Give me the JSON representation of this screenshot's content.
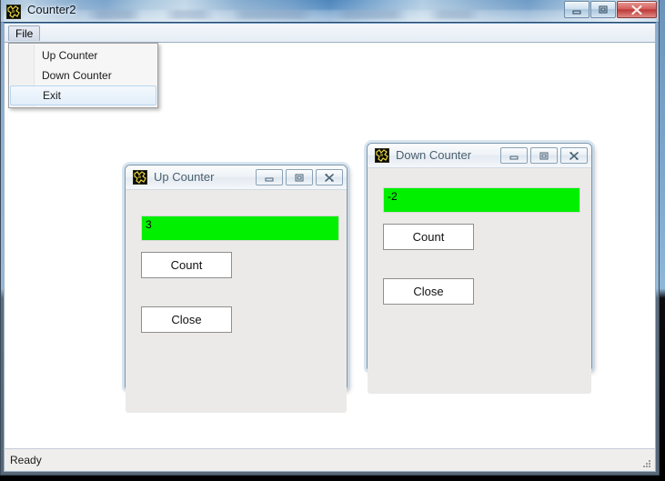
{
  "main_window": {
    "title": "Counter2",
    "icon": "app-icon",
    "caption_buttons": [
      {
        "name": "minimize",
        "glyph": "minimize-icon"
      },
      {
        "name": "maximize",
        "glyph": "maximize-icon"
      },
      {
        "name": "close",
        "glyph": "close-icon"
      }
    ],
    "menubar": {
      "items": [
        {
          "label": "File"
        }
      ]
    },
    "dropdown": {
      "open": true,
      "items": [
        {
          "label": "Up Counter",
          "highlighted": false
        },
        {
          "label": "Down Counter",
          "highlighted": false
        },
        {
          "label": "Exit",
          "highlighted": true
        }
      ]
    },
    "statusbar": {
      "text": "Ready"
    }
  },
  "child_windows": [
    {
      "id": "up-counter",
      "title": "Up Counter",
      "icon": "app-icon",
      "counter_value": "3",
      "buttons": [
        {
          "label": "Count"
        },
        {
          "label": "Close"
        }
      ],
      "caption_buttons": [
        {
          "name": "minimize",
          "glyph": "minimize-icon"
        },
        {
          "name": "maximize",
          "glyph": "maximize-icon"
        },
        {
          "name": "close",
          "glyph": "close-icon"
        }
      ]
    },
    {
      "id": "down-counter",
      "title": "Down Counter",
      "icon": "app-icon",
      "counter_value": "-2",
      "buttons": [
        {
          "label": "Count"
        },
        {
          "label": "Close"
        }
      ],
      "caption_buttons": [
        {
          "name": "minimize",
          "glyph": "minimize-icon"
        },
        {
          "name": "maximize",
          "glyph": "maximize-icon"
        },
        {
          "name": "close",
          "glyph": "close-icon"
        }
      ]
    }
  ],
  "colors": {
    "counter_field_green": "#00f000",
    "close_button_red": "#bc3a38",
    "titlebar_glass": "#8fb2d2",
    "client_white": "#ffffff",
    "status_bg": "#f0eeec"
  }
}
